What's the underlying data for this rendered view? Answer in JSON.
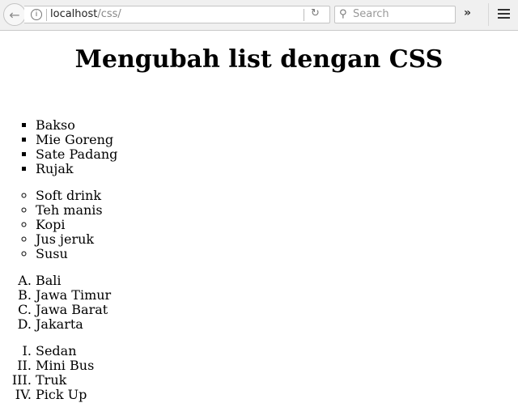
{
  "browser": {
    "url_host": "localhost",
    "url_path": "/css/",
    "search_placeholder": "Search",
    "icons": {
      "back": "←",
      "info": "i",
      "reload": "↻",
      "search": "⚲",
      "overflow": "»"
    }
  },
  "page": {
    "title": "Mengubah list dengan CSS",
    "lists": {
      "square": [
        "Bakso",
        "Mie Goreng",
        "Sate Padang",
        "Rujak"
      ],
      "circle": [
        "Soft drink",
        "Teh manis",
        "Kopi",
        "Jus jeruk",
        "Susu"
      ],
      "upper_alpha": [
        "Bali",
        "Jawa Timur",
        "Jawa Barat",
        "Jakarta"
      ],
      "upper_roman": [
        "Sedan",
        "Mini Bus",
        "Truk",
        "Pick Up"
      ]
    }
  }
}
